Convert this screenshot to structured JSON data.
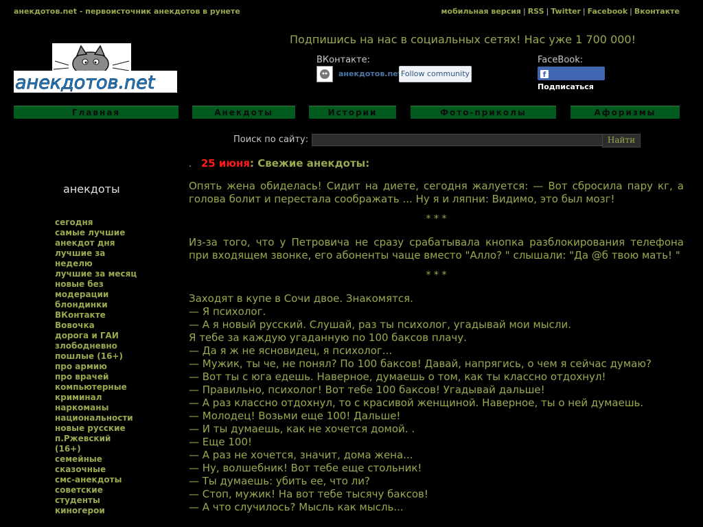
{
  "header": {
    "site_title": "анекдотов.net - первоисточник анекдотов в рунете",
    "top_links": [
      "мобильная версия",
      "RSS",
      "Twitter",
      "Facebook",
      "Вконтакте"
    ],
    "logo_text": "анекдотов.net"
  },
  "social": {
    "heading": "Подпишись на нас в социальных сетях! Нас уже 1 700 000!",
    "vk_label": "ВКонтакте:",
    "vk_name": "анекдотов.net",
    "vk_follow": "Follow community",
    "fb_label": "FaceBook:",
    "fb_button": "Подписаться"
  },
  "nav": [
    "Главная",
    "Анекдоты",
    "Истории",
    "Фото-приколы",
    "Афоризмы"
  ],
  "search": {
    "label": "Поиск по сайту:",
    "button": "Найти",
    "value": ""
  },
  "date_line": {
    "date": "25 июня",
    "title": ": Свежие анекдоты:"
  },
  "sidebar": {
    "title": "анекдоты",
    "items": [
      "сегодня",
      "самые лучшие",
      "анекдот дня",
      "лучшие за неделю",
      "лучшие за месяц",
      "новые без модерации",
      "блондинки",
      "ВКонтакте",
      "Вовочка",
      "дорога и ГАИ",
      "злободневно",
      "пошлые (16+)",
      "про армию",
      "про врачей",
      "компьютерные",
      "криминал",
      "наркоманы",
      "национальности",
      "новые русские",
      "п.Ржевский (16+)",
      "семейные",
      "сказочные",
      "смс-анекдоты",
      "советские",
      "студенты",
      "киногерои"
    ]
  },
  "jokes": {
    "joke1": "Опять жена обиделась! Сидит на диете, сегодня жалуется: — Вот сбросила пару кг, а голова болит и перестала соображать ... Ну я и ляпни: Видимо, это был мозг!",
    "separator": "* * *",
    "joke2": "Из-за того, что у Петровича не сразу срабатывала кнопка разблокирования телефона при входящем звонке, его абоненты чаще вместо \"Алло? \" слышали: \"Да @б твою мать! \"",
    "joke3_lines": [
      "Заходят в купе в Сочи двое. Знакомятся.",
      "— Я психолог.",
      "— А я новый русский. Слушай, раз ты психолог, угадывай мои мысли.",
      "Я тебе за каждую угаданную по 100 баксов плачу.",
      "— Да я ж не ясновидец, я психолог...",
      "— Мужик, ты че, не понял? По 100 баксов! Давай, напрягись, о чем я сейчас думаю?",
      "— Вот ты с юга едешь. Наверное, думаешь о том, как ты классно отдохнул!",
      "— Правильно, психолог! Вот тебе 100 баксов! Угадывай дальше!",
      "— А раз классно отдохнул, то с красивой женщиной. Наверное, ты о ней думаешь.",
      "— Молодец! Возьми еще 100! Дальше!",
      "— И ты думаешь, как не хочется домой. .",
      "— Еще 100!",
      "— А раз не хочется, значит, дома жена...",
      "— Ну, волшебник! Вот тебе еще стольник!",
      "— Ты думаешь: убить ее, что ли?",
      "— Стоп, мужик! На вот тебе тысячу баксов!",
      "— А что случилось? Мысль как мысль..."
    ]
  },
  "colors": {
    "text": "#9aa84e",
    "nav_bg": "#005a1e",
    "date": "#ff1a1a",
    "background": "#000000"
  }
}
